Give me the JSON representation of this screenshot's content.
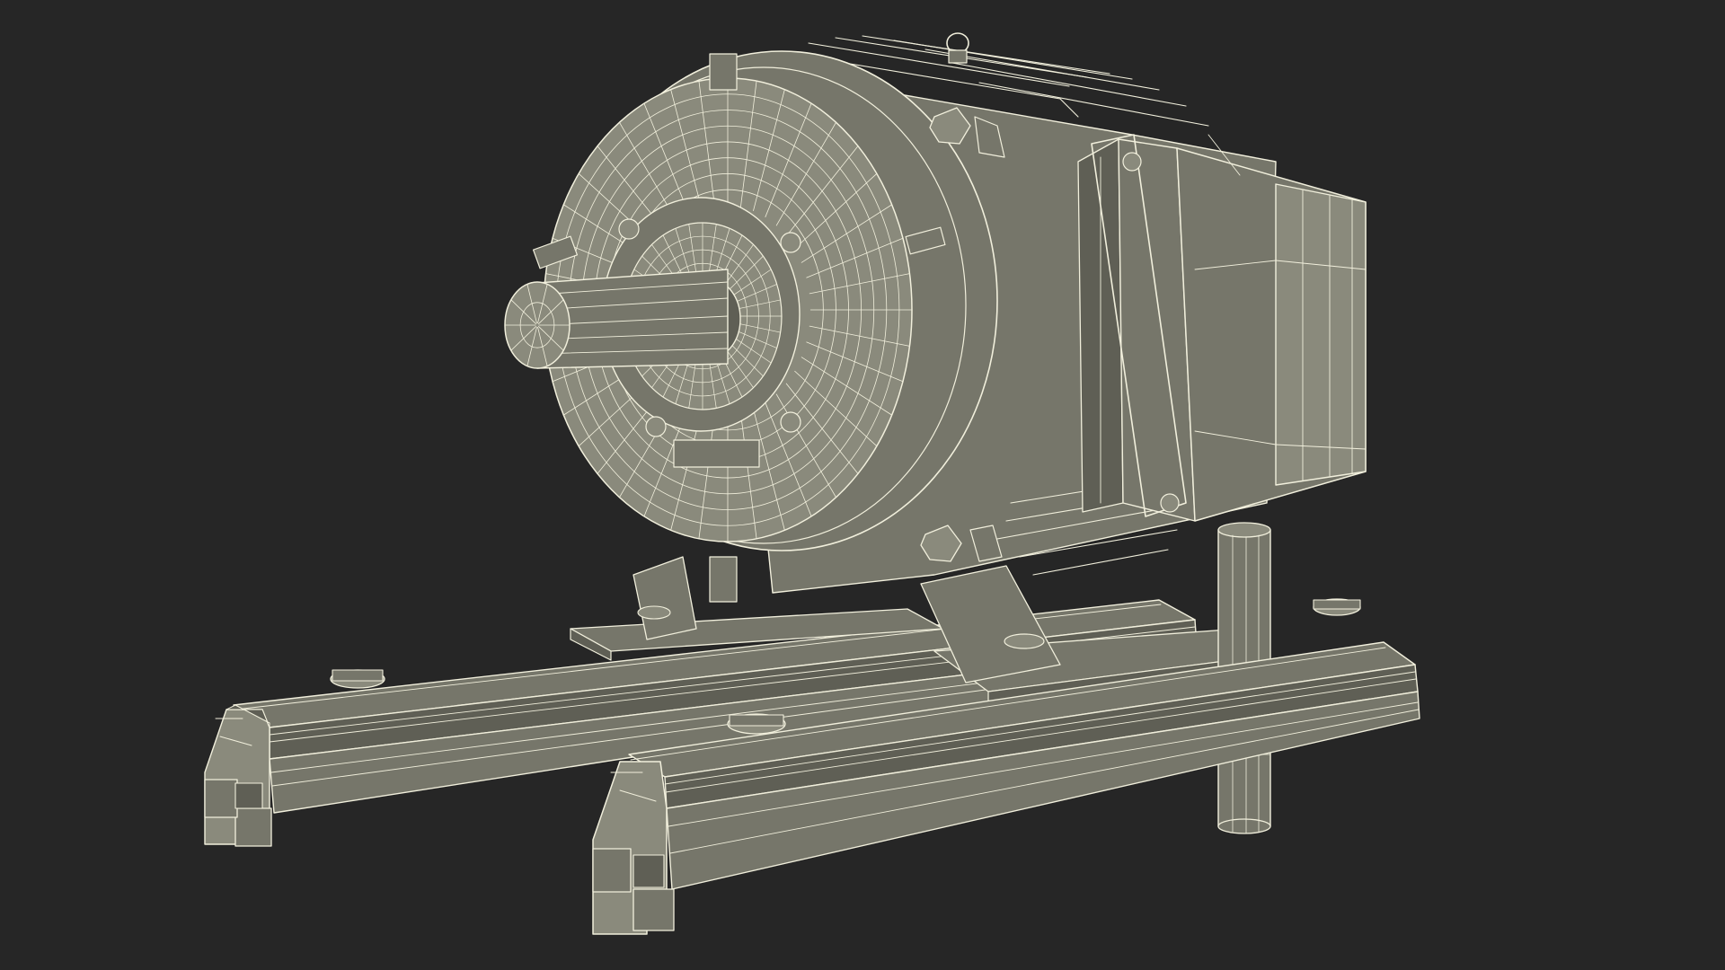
{
  "scene": {
    "background_color": "#262626",
    "surface_color": "#76766a",
    "surface_dark_color": "#5f5f55",
    "surface_light_color": "#8a8a7c",
    "wire_color": "#f1efdc",
    "subject": "electric-motor-on-rails-wireframe-render"
  }
}
